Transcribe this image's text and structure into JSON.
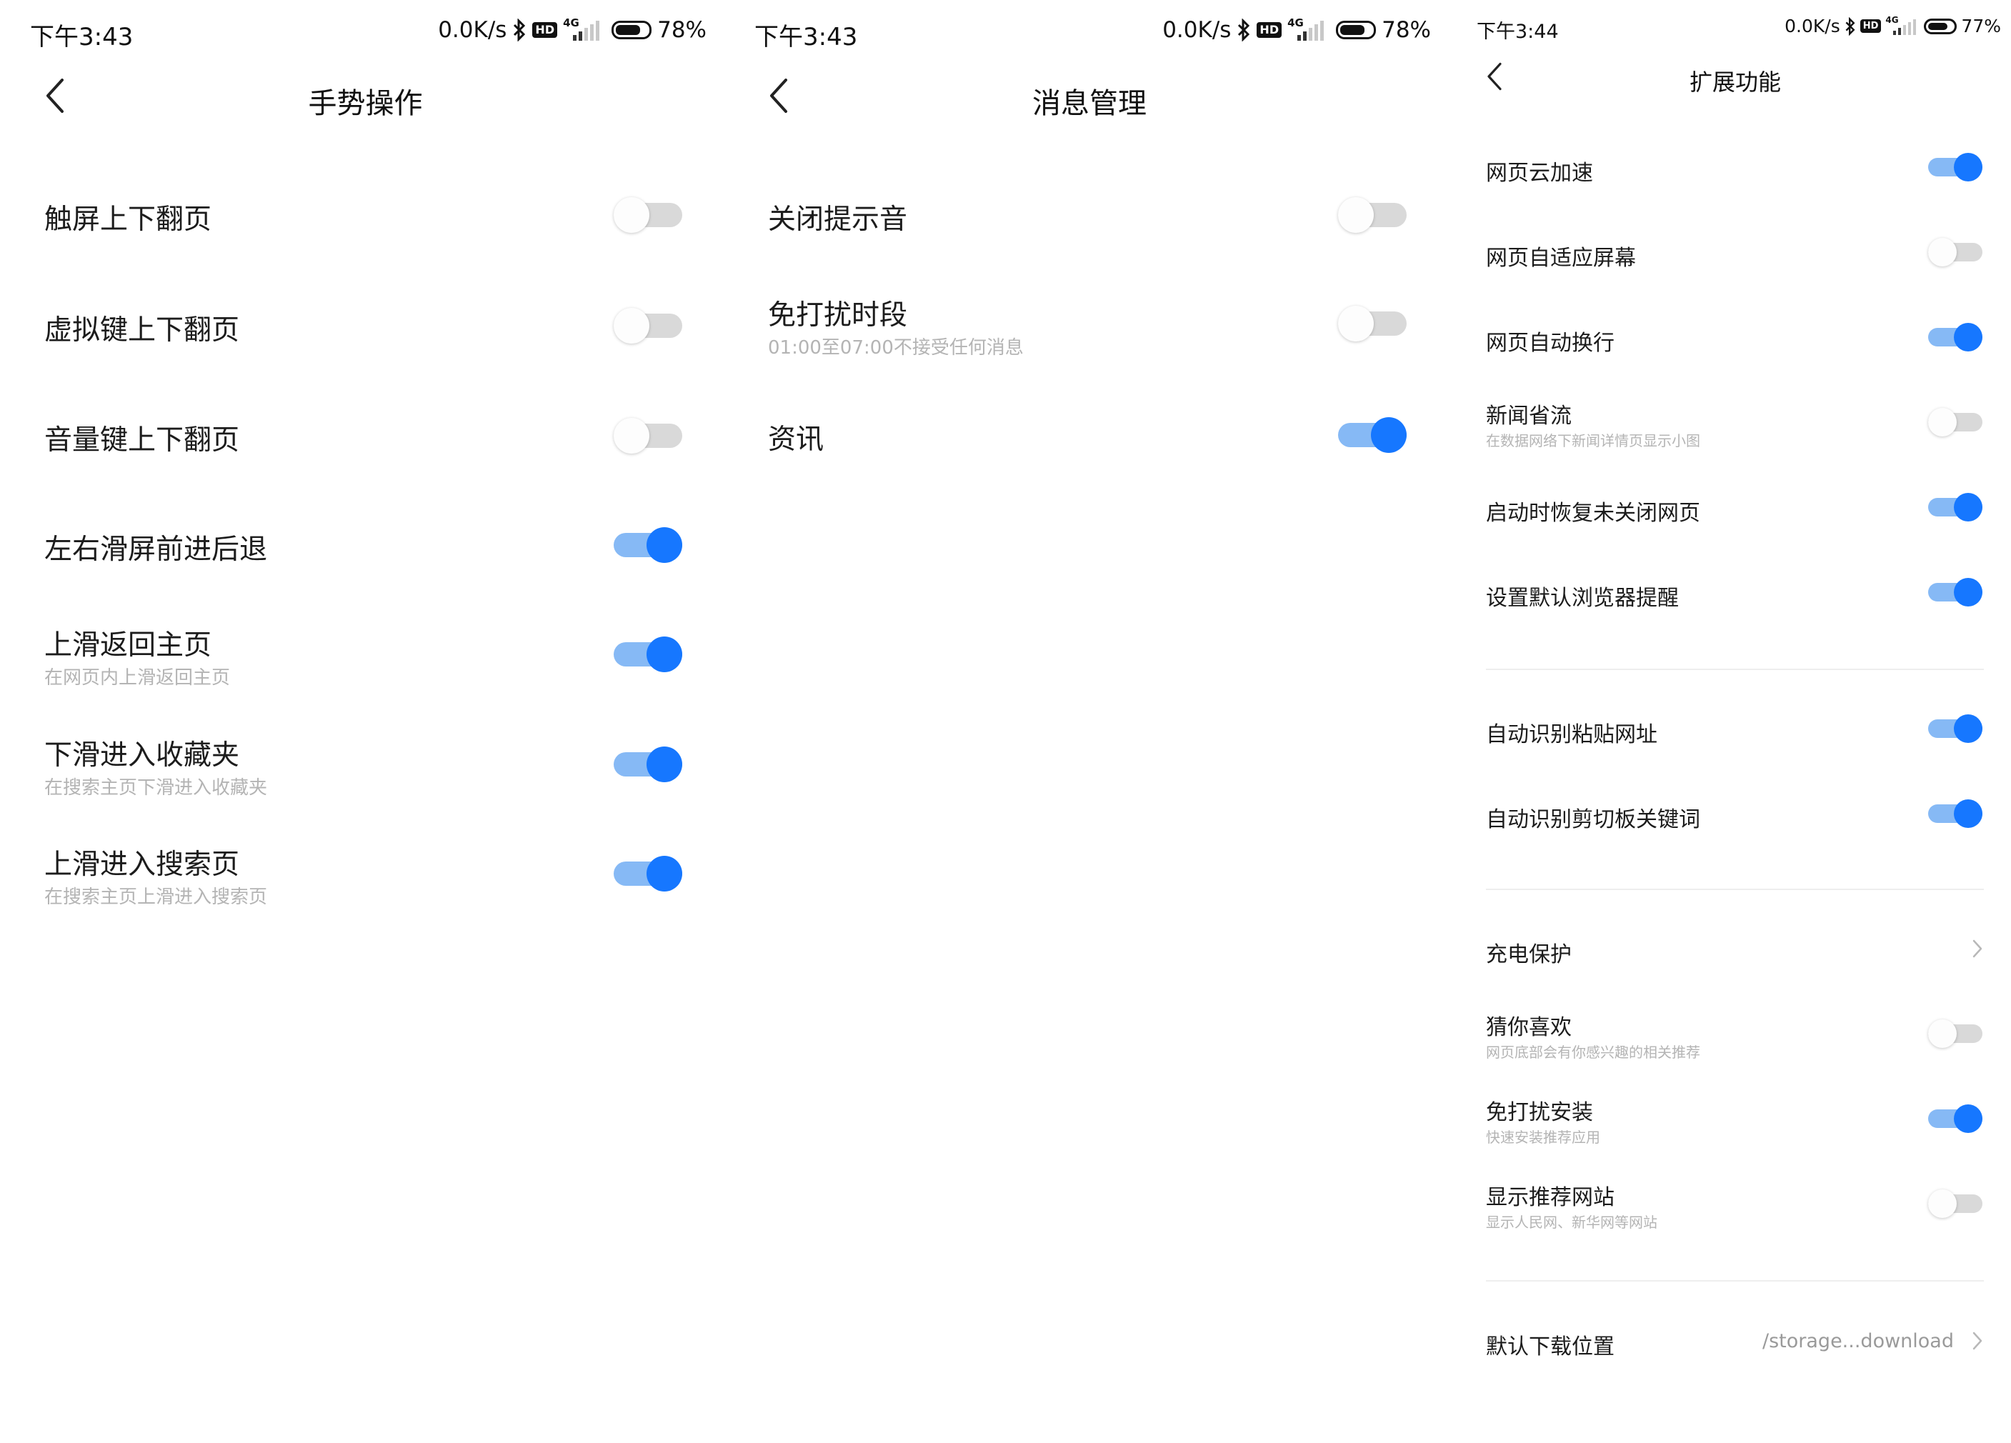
{
  "colors": {
    "accent": "#1677ff",
    "accent_track": "#86b9f5",
    "off_track": "#d9d9d9",
    "subtext": "#b4b4b4"
  },
  "panels": [
    {
      "status": {
        "time": "下午3:43",
        "speed": "0.0K/s",
        "network": "4G",
        "battery": "78%",
        "battery_level": 0.78
      },
      "header": {
        "title": "手势操作"
      },
      "items": [
        {
          "label": "触屏上下翻页",
          "toggle": false
        },
        {
          "label": "虚拟键上下翻页",
          "toggle": false
        },
        {
          "label": "音量键上下翻页",
          "toggle": false
        },
        {
          "label": "左右滑屏前进后退",
          "toggle": true
        },
        {
          "label": "上滑返回主页",
          "sub": "在网页内上滑返回主页",
          "toggle": true
        },
        {
          "label": "下滑进入收藏夹",
          "sub": "在搜索主页下滑进入收藏夹",
          "toggle": true
        },
        {
          "label": "上滑进入搜索页",
          "sub": "在搜索主页上滑进入搜索页",
          "toggle": true
        }
      ]
    },
    {
      "status": {
        "time": "下午3:43",
        "speed": "0.0K/s",
        "network": "4G",
        "battery": "78%",
        "battery_level": 0.78
      },
      "header": {
        "title": "消息管理"
      },
      "items": [
        {
          "label": "关闭提示音",
          "toggle": false
        },
        {
          "label": "免打扰时段",
          "sub": "01:00至07:00不接受任何消息",
          "toggle": false
        },
        {
          "label": "资讯",
          "toggle": true
        }
      ]
    },
    {
      "status": {
        "time": "下午3:44",
        "speed": "0.0K/s",
        "network": "4G",
        "battery": "77%",
        "battery_level": 0.77
      },
      "header": {
        "title": "扩展功能"
      },
      "items": [
        {
          "label": "网页云加速",
          "toggle": true
        },
        {
          "label": "网页自适应屏幕",
          "toggle": false
        },
        {
          "label": "网页自动换行",
          "toggle": true
        },
        {
          "label": "新闻省流",
          "sub": "在数据网络下新闻详情页显示小图",
          "toggle": false
        },
        {
          "label": "启动时恢复未关闭网页",
          "toggle": true
        },
        {
          "label": "设置默认浏览器提醒",
          "toggle": true
        },
        {
          "label": "自动识别粘贴网址",
          "toggle": true
        },
        {
          "label": "自动识别剪切板关键词",
          "toggle": true
        },
        {
          "label": "充电保护",
          "chevron": true
        },
        {
          "label": "猜你喜欢",
          "sub": "网页底部会有你感兴趣的相关推荐",
          "toggle": false
        },
        {
          "label": "免打扰安装",
          "sub": "快速安装推荐应用",
          "toggle": true
        },
        {
          "label": "显示推荐网站",
          "sub": "显示人民网、新华网等网站",
          "toggle": false
        },
        {
          "label": "默认下载位置",
          "value": "/storage...download",
          "chevron": true
        }
      ]
    }
  ]
}
